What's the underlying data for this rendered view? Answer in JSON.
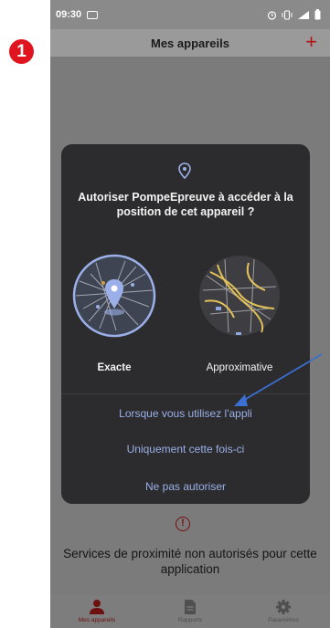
{
  "step_badge": "1",
  "status_bar": {
    "time": "09:30"
  },
  "app_bar": {
    "title": "Mes appareils",
    "add_label": "+"
  },
  "dialog": {
    "title": "Autoriser PompeEpreuve à accéder à la position de cet appareil ?",
    "options": {
      "exact": "Exacte",
      "approximate": "Approximative"
    },
    "buttons": {
      "while_using": "Lorsque vous utilisez l'appli",
      "only_this_time": "Uniquement cette fois-ci",
      "deny": "Ne pas autoriser"
    }
  },
  "content": {
    "warning_message": "Services de proximité non autorisés pour cette application"
  },
  "bottom_nav": {
    "items": [
      {
        "label": "Mes appareils",
        "icon": "person-icon",
        "active": true
      },
      {
        "label": "Rapports",
        "icon": "document-icon",
        "active": false
      },
      {
        "label": "Paramètres",
        "icon": "gear-icon",
        "active": false
      }
    ]
  },
  "colors": {
    "accent_red": "#b21414",
    "badge_red": "#e0141e",
    "dialog_bg": "#2c2c2e",
    "dialog_button_text": "#9bb0e8",
    "annotation_arrow": "#3b6fd1"
  }
}
